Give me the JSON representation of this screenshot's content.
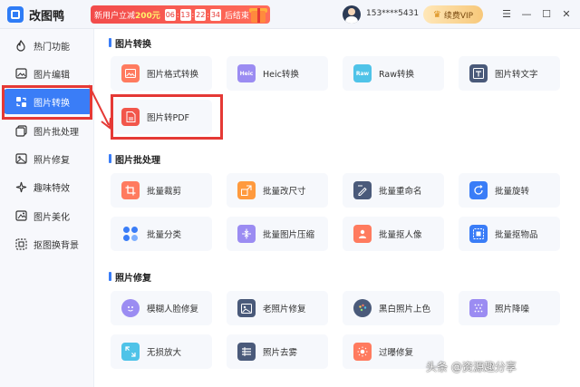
{
  "app": {
    "title": "改图鸭"
  },
  "promo": {
    "text_before": "新用户立减",
    "amount": "200元",
    "cd_days": "06",
    "cd_hours": "13",
    "cd_mins": "22",
    "cd_secs": "34",
    "text_after": "后结束"
  },
  "user": {
    "phone": "153****5431",
    "vip_label": "续费VIP"
  },
  "window_controls": {
    "menu": "☰",
    "minimize": "—",
    "maximize": "☐",
    "close": "✕"
  },
  "sidebar": {
    "items": [
      {
        "label": "热门功能",
        "icon": "flame-icon"
      },
      {
        "label": "图片编辑",
        "icon": "image-edit-icon"
      },
      {
        "label": "图片转换",
        "icon": "convert-icon",
        "active": true
      },
      {
        "label": "图片批处理",
        "icon": "batch-icon"
      },
      {
        "label": "照片修复",
        "icon": "photo-repair-icon"
      },
      {
        "label": "趣味特效",
        "icon": "sparkle-icon"
      },
      {
        "label": "图片美化",
        "icon": "beautify-icon"
      },
      {
        "label": "抠图换背景",
        "icon": "cutout-icon"
      }
    ]
  },
  "sections": {
    "convert": {
      "title": "图片转换",
      "cards": [
        "图片格式转换",
        "Heic转换",
        "Raw转换",
        "图片转文字",
        "图片转PDF"
      ]
    },
    "batch": {
      "title": "图片批处理",
      "cards": [
        "批量裁剪",
        "批量改尺寸",
        "批量重命名",
        "批量旋转",
        "批量分类",
        "批量图片压缩",
        "批量抠人像",
        "批量抠物品"
      ]
    },
    "repair": {
      "title": "照片修复",
      "cards": [
        "模糊人脸修复",
        "老照片修复",
        "黑白照片上色",
        "照片降噪",
        "无损放大",
        "照片去雾",
        "过曝修复"
      ]
    }
  },
  "icon_badges": {
    "heic": "Heic",
    "raw": "Raw"
  },
  "colors": {
    "accent": "#3a7df7",
    "highlight": "#e53935",
    "promo": "#f24b4b"
  },
  "watermark": "头条 @资源趣分享"
}
